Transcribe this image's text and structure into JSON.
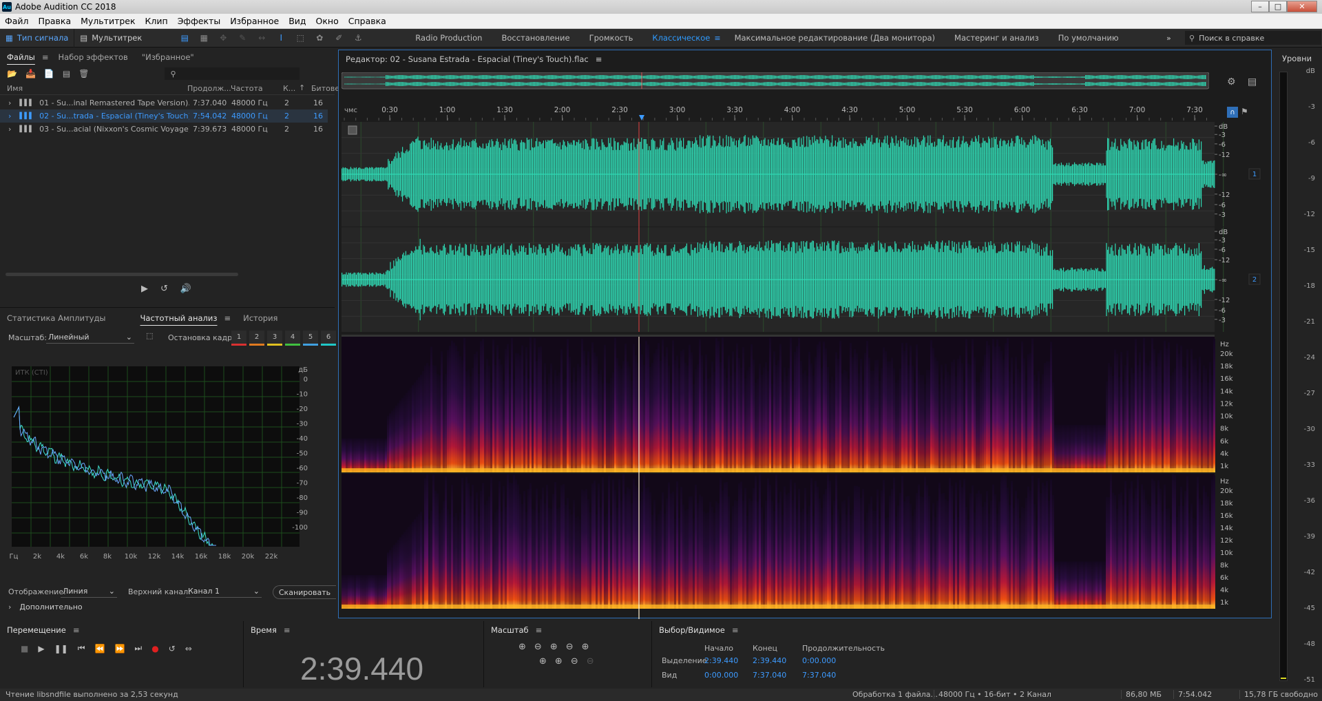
{
  "app": {
    "logo": "Au",
    "title": "Adobe Audition CC 2018"
  },
  "menu": [
    "Файл",
    "Правка",
    "Мультитрек",
    "Клип",
    "Эффекты",
    "Избранное",
    "Вид",
    "Окно",
    "Справка"
  ],
  "toolbar": {
    "waveform_mode": "Тип сигнала",
    "multitrack_mode": "Мультитрек",
    "search_placeholder": "Поиск в справке"
  },
  "workspaces": [
    "Radio Production",
    "Восстановление",
    "Громкость",
    "Классическое",
    "Максимальное редактирование (Два монитора)",
    "Мастеринг и анализ",
    "По умолчанию"
  ],
  "active_workspace": "Классическое",
  "files_panel": {
    "tabs": [
      "Файлы",
      "Набор эффектов",
      "\"Избранное\""
    ],
    "columns": [
      "Имя",
      "Продолж...",
      "Частота",
      "К...",
      "Битове"
    ],
    "rows": [
      {
        "name": "01 - Su...inal Remastered Tape Version).flac",
        "duration": "7:37.040",
        "rate": "48000 Гц",
        "ch": "2",
        "bits": "16",
        "selected": false
      },
      {
        "name": "02 - Su...trada - Espacial (Tiney's Touch).flac",
        "duration": "7:54.042",
        "rate": "48000 Гц",
        "ch": "2",
        "bits": "16",
        "selected": true
      },
      {
        "name": "03 - Su...acial (Nixxon's Cosmic Voyage).flac",
        "duration": "7:39.673",
        "rate": "48000 Гц",
        "ch": "2",
        "bits": "16",
        "selected": false
      }
    ]
  },
  "analysis_panel": {
    "tabs": [
      "Статистика Амплитуды",
      "Частотный анализ",
      "История"
    ],
    "scale_label": "Масштаб:",
    "scale_value": "Линейный",
    "freeze_label": "Остановка кадра:",
    "freeze_buttons": [
      "1",
      "2",
      "3",
      "4",
      "5",
      "6"
    ],
    "freeze_colors": [
      "#d93030",
      "#e07a20",
      "#e0c020",
      "#40c040",
      "#40a0e0",
      "#20c8c8"
    ],
    "graph_label": "ИТК (СТІ)",
    "db_ticks": [
      "дБ",
      "0",
      "-10",
      "-20",
      "-30",
      "-40",
      "-50",
      "-60",
      "-70",
      "-80",
      "-90",
      "-100"
    ],
    "freq_ticks": [
      "Гц",
      "2k",
      "4k",
      "6k",
      "8k",
      "10k",
      "12k",
      "14k",
      "16k",
      "18k",
      "20k",
      "22k"
    ],
    "display_label": "Отображение:",
    "display_value": "Линия",
    "channel_label": "Верхний канал:",
    "channel_value": "Канал 1",
    "scan_button": "Сканировать",
    "more_label": "Дополнительно"
  },
  "editor": {
    "title": "Редактор: 02 - Susana Estrada - Espacial (Tiney's Touch).flac",
    "time_unit": "чмс",
    "time_ticks": [
      "0:30",
      "1:00",
      "1:30",
      "2:00",
      "2:30",
      "3:00",
      "3:30",
      "4:00",
      "4:30",
      "5:00",
      "5:30",
      "6:00",
      "6:30",
      "7:00",
      "7:30"
    ],
    "db_scale_1": [
      "dB",
      "-3",
      "-6",
      "-12",
      "-∞",
      "-12",
      "-6",
      "-3"
    ],
    "db_scale_2": [
      "dB",
      "-3",
      "-6",
      "-12",
      "-∞",
      "-12",
      "-6",
      "-3"
    ],
    "channels": [
      "1",
      "2"
    ],
    "hz_scale": [
      "Hz",
      "20k",
      "18k",
      "16k",
      "14k",
      "12k",
      "10k",
      "8k",
      "6k",
      "4k",
      "1k"
    ],
    "wave_color": "#2fd9b4"
  },
  "levels": {
    "title": "Уровни",
    "ticks": [
      "dB",
      "-3",
      "-6",
      "-9",
      "-12",
      "-15",
      "-18",
      "-21",
      "-24",
      "-27",
      "-30",
      "-33",
      "-36",
      "-39",
      "-42",
      "-45",
      "-48",
      "-51"
    ]
  },
  "transport": {
    "title": "Перемещение"
  },
  "time_panel": {
    "title": "Время",
    "value": "2:39.440"
  },
  "zoom_panel": {
    "title": "Масштаб"
  },
  "selection_panel": {
    "title": "Выбор/Видимое",
    "col_start": "Начало",
    "col_end": "Конец",
    "col_duration": "Продолжительность",
    "row_selection": "Выделение",
    "row_view": "Вид",
    "sel_start": "2:39.440",
    "sel_end": "2:39.440",
    "sel_dur": "0:00.000",
    "view_start": "0:00.000",
    "view_end": "7:37.040",
    "view_dur": "7:37.040"
  },
  "status": {
    "left": "Чтение libsndfile выполнено за 2,53 секунд",
    "processing": "Обработка 1 файла...",
    "format": "48000 Гц • 16-бит • 2 Канал",
    "size": "86,80 МБ",
    "duration": "7:54.042",
    "free": "15,78 ГБ свободно"
  }
}
